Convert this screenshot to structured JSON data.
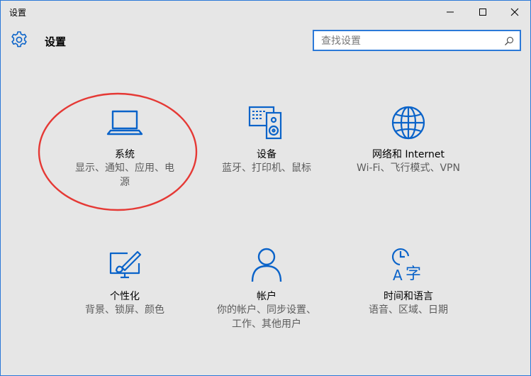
{
  "window": {
    "title": "设置",
    "controls": {
      "minimize": "minimize",
      "maximize": "maximize",
      "close": "close"
    }
  },
  "header": {
    "title": "设置",
    "search_placeholder": "查找设置"
  },
  "tiles": [
    {
      "label": "系统",
      "desc_line1": "显示、通知、应用、电",
      "desc_line2": "源",
      "icon": "laptop-icon"
    },
    {
      "label": "设备",
      "desc_line1": "蓝牙、打印机、鼠标",
      "desc_line2": "",
      "icon": "devices-icon"
    },
    {
      "label": "网络和 Internet",
      "desc_line1": "Wi-Fi、飞行模式、VPN",
      "desc_line2": "",
      "icon": "globe-icon"
    },
    {
      "label": "个性化",
      "desc_line1": "背景、锁屏、颜色",
      "desc_line2": "",
      "icon": "personalization-icon"
    },
    {
      "label": "帐户",
      "desc_line1": "你的帐户、同步设置、",
      "desc_line2": "工作、其他用户",
      "icon": "account-icon"
    },
    {
      "label": "时间和语言",
      "desc_line1": "语音、区域、日期",
      "desc_line2": "",
      "icon": "time-language-icon"
    }
  ],
  "colors": {
    "accent": "#0a63c9",
    "window_border": "#2b79d8",
    "background": "#e6e6e6",
    "annotation": "#e53935"
  }
}
